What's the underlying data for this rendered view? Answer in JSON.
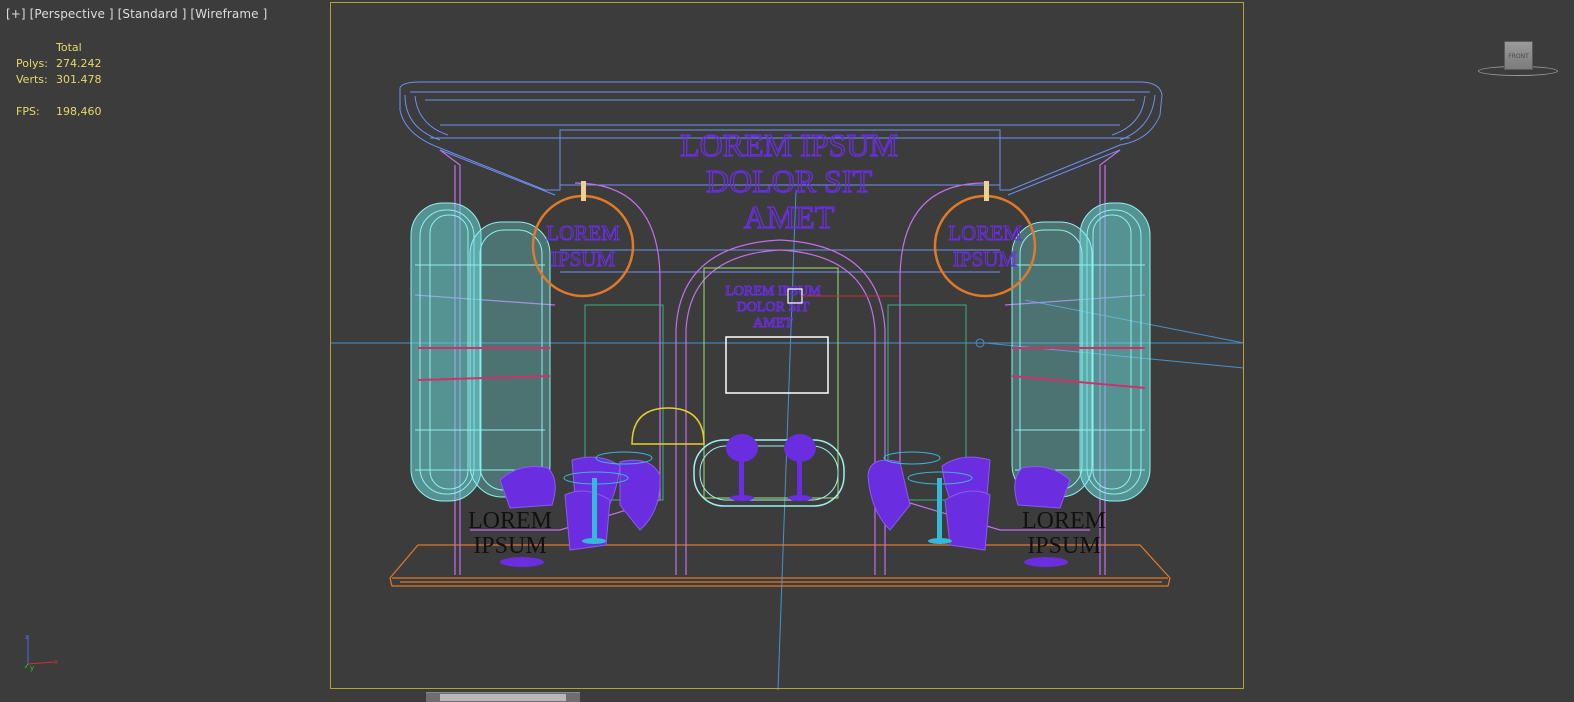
{
  "viewport": {
    "label": "[+] [Perspective ] [Standard ] [Wireframe ]"
  },
  "stats": {
    "total_label": "Total",
    "polys_label": "Polys:",
    "polys_value": "274.242",
    "verts_label": "Verts:",
    "verts_value": "301.478",
    "fps_label": "FPS:",
    "fps_value": "198,460"
  },
  "scene": {
    "sign_main": [
      "LOREM IPSUM",
      "DOLOR SIT",
      "AMET"
    ],
    "sign_center": [
      "LOREM IPSUM",
      "DOLOR SIT",
      "AMET"
    ],
    "circle_sign_left": [
      "LOREM",
      "IPSUM"
    ],
    "circle_sign_right": [
      "LOREM",
      "IPSUM"
    ],
    "counter_left": [
      "LOREM",
      "IPSUM"
    ],
    "counter_right": [
      "LOREM",
      "IPSUM"
    ]
  },
  "viewcube": {
    "face_label": "FRONT"
  },
  "axis": {
    "z_label": "z",
    "y_label": "y",
    "x_label": "x"
  },
  "colors": {
    "background": "#3c3c3c",
    "safe_frame": "#b3a334",
    "stats_text": "#e6d86a",
    "wire_blue": "#6f8ff0",
    "wire_magenta": "#c070e8",
    "wire_cyan": "#90f0f0",
    "wire_orange": "#e07a2a",
    "wire_purple": "#6a2ee0",
    "wire_green": "#38b080"
  }
}
